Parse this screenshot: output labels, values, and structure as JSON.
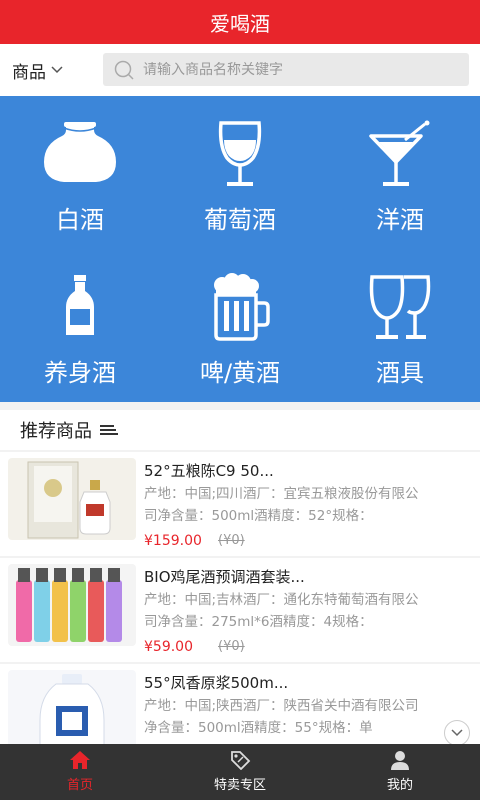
{
  "app": {
    "title": "爱喝酒"
  },
  "search": {
    "category_label": "商品",
    "placeholder": "请输入商品名称关键字"
  },
  "categories": [
    {
      "label": "白酒",
      "icon": "baijiu-jar-icon"
    },
    {
      "label": "葡萄酒",
      "icon": "wine-glass-icon"
    },
    {
      "label": "洋酒",
      "icon": "cocktail-glass-icon"
    },
    {
      "label": "养身酒",
      "icon": "bottle-icon"
    },
    {
      "label": "啤/黄酒",
      "icon": "beer-mug-icon"
    },
    {
      "label": "酒具",
      "icon": "glasses-icon"
    }
  ],
  "recommend": {
    "title": "推荐商品"
  },
  "products": [
    {
      "name": "52°五粮陈C9 50...",
      "desc": "产地：中国;四川酒厂：宜宾五粮液股份有限公司净含量：500ml酒精度：52°规格：",
      "price": "¥159.00",
      "original_price": "(¥0)"
    },
    {
      "name": "BIO鸡尾酒预调酒套装...",
      "desc": "产地：中国;吉林酒厂：通化东特葡萄酒有限公司净含量：275ml*6酒精度：4规格：",
      "price": "¥59.00",
      "original_price": "(¥0)"
    },
    {
      "name": "55°凤香原浆500m...",
      "desc": "产地：中国;陕西酒厂：陕西省关中酒有限公司净含量：500ml酒精度：55°规格：单",
      "price": "",
      "original_price": ""
    }
  ],
  "tabs": [
    {
      "label": "首页",
      "icon": "home-icon",
      "active": true
    },
    {
      "label": "特卖专区",
      "icon": "price-tag-icon",
      "active": false
    },
    {
      "label": "我的",
      "icon": "user-icon",
      "active": false
    }
  ],
  "colors": {
    "brand_red": "#e8252b",
    "category_blue": "#3c86d9",
    "tabbar_dark": "#333333"
  }
}
